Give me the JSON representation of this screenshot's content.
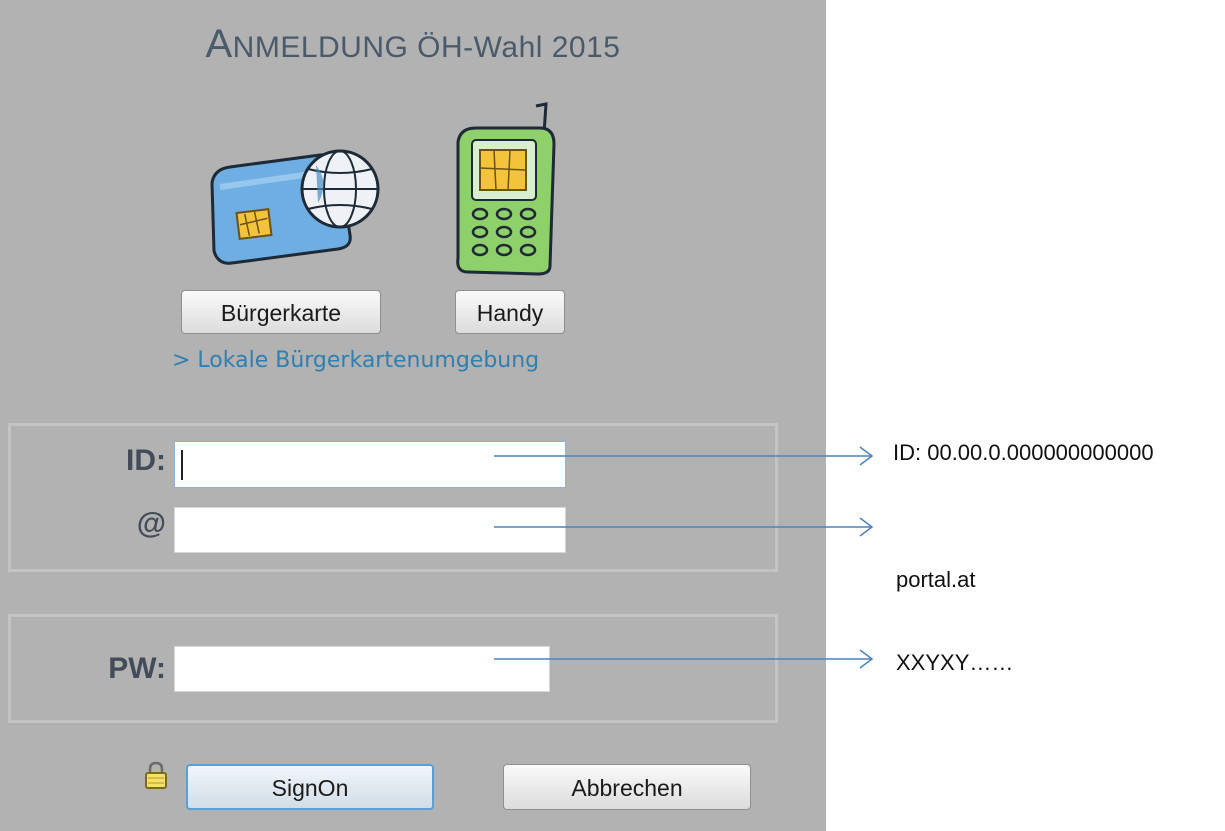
{
  "title": {
    "cap": "A",
    "rest": "NMELDUNG ÖH-Wahl 2015"
  },
  "icons": {
    "card": "buergerkarte-card-globe-icon",
    "phone": "handy-phone-icon",
    "lock": "lock-icon"
  },
  "buttons": {
    "buergerkarte": "Bürgerkarte",
    "handy": "Handy",
    "signon": "SignOn",
    "abbrechen": "Abbrechen"
  },
  "link": {
    "lokale": "> Lokale Bürgerkartenumgebung"
  },
  "form": {
    "id_label": "ID:",
    "at_label": "@",
    "pw_label": "PW:",
    "id_value": "",
    "at_value": "",
    "pw_value": ""
  },
  "annotations": {
    "id": "ID: 00.00.0.000000000000",
    "at": "portal.at",
    "pw": "XXYXY……"
  },
  "colors": {
    "panel_bg": "#b2b2b2",
    "title": "#4a5a6a",
    "link": "#2f7fb0",
    "arrow": "#4f81bd"
  }
}
